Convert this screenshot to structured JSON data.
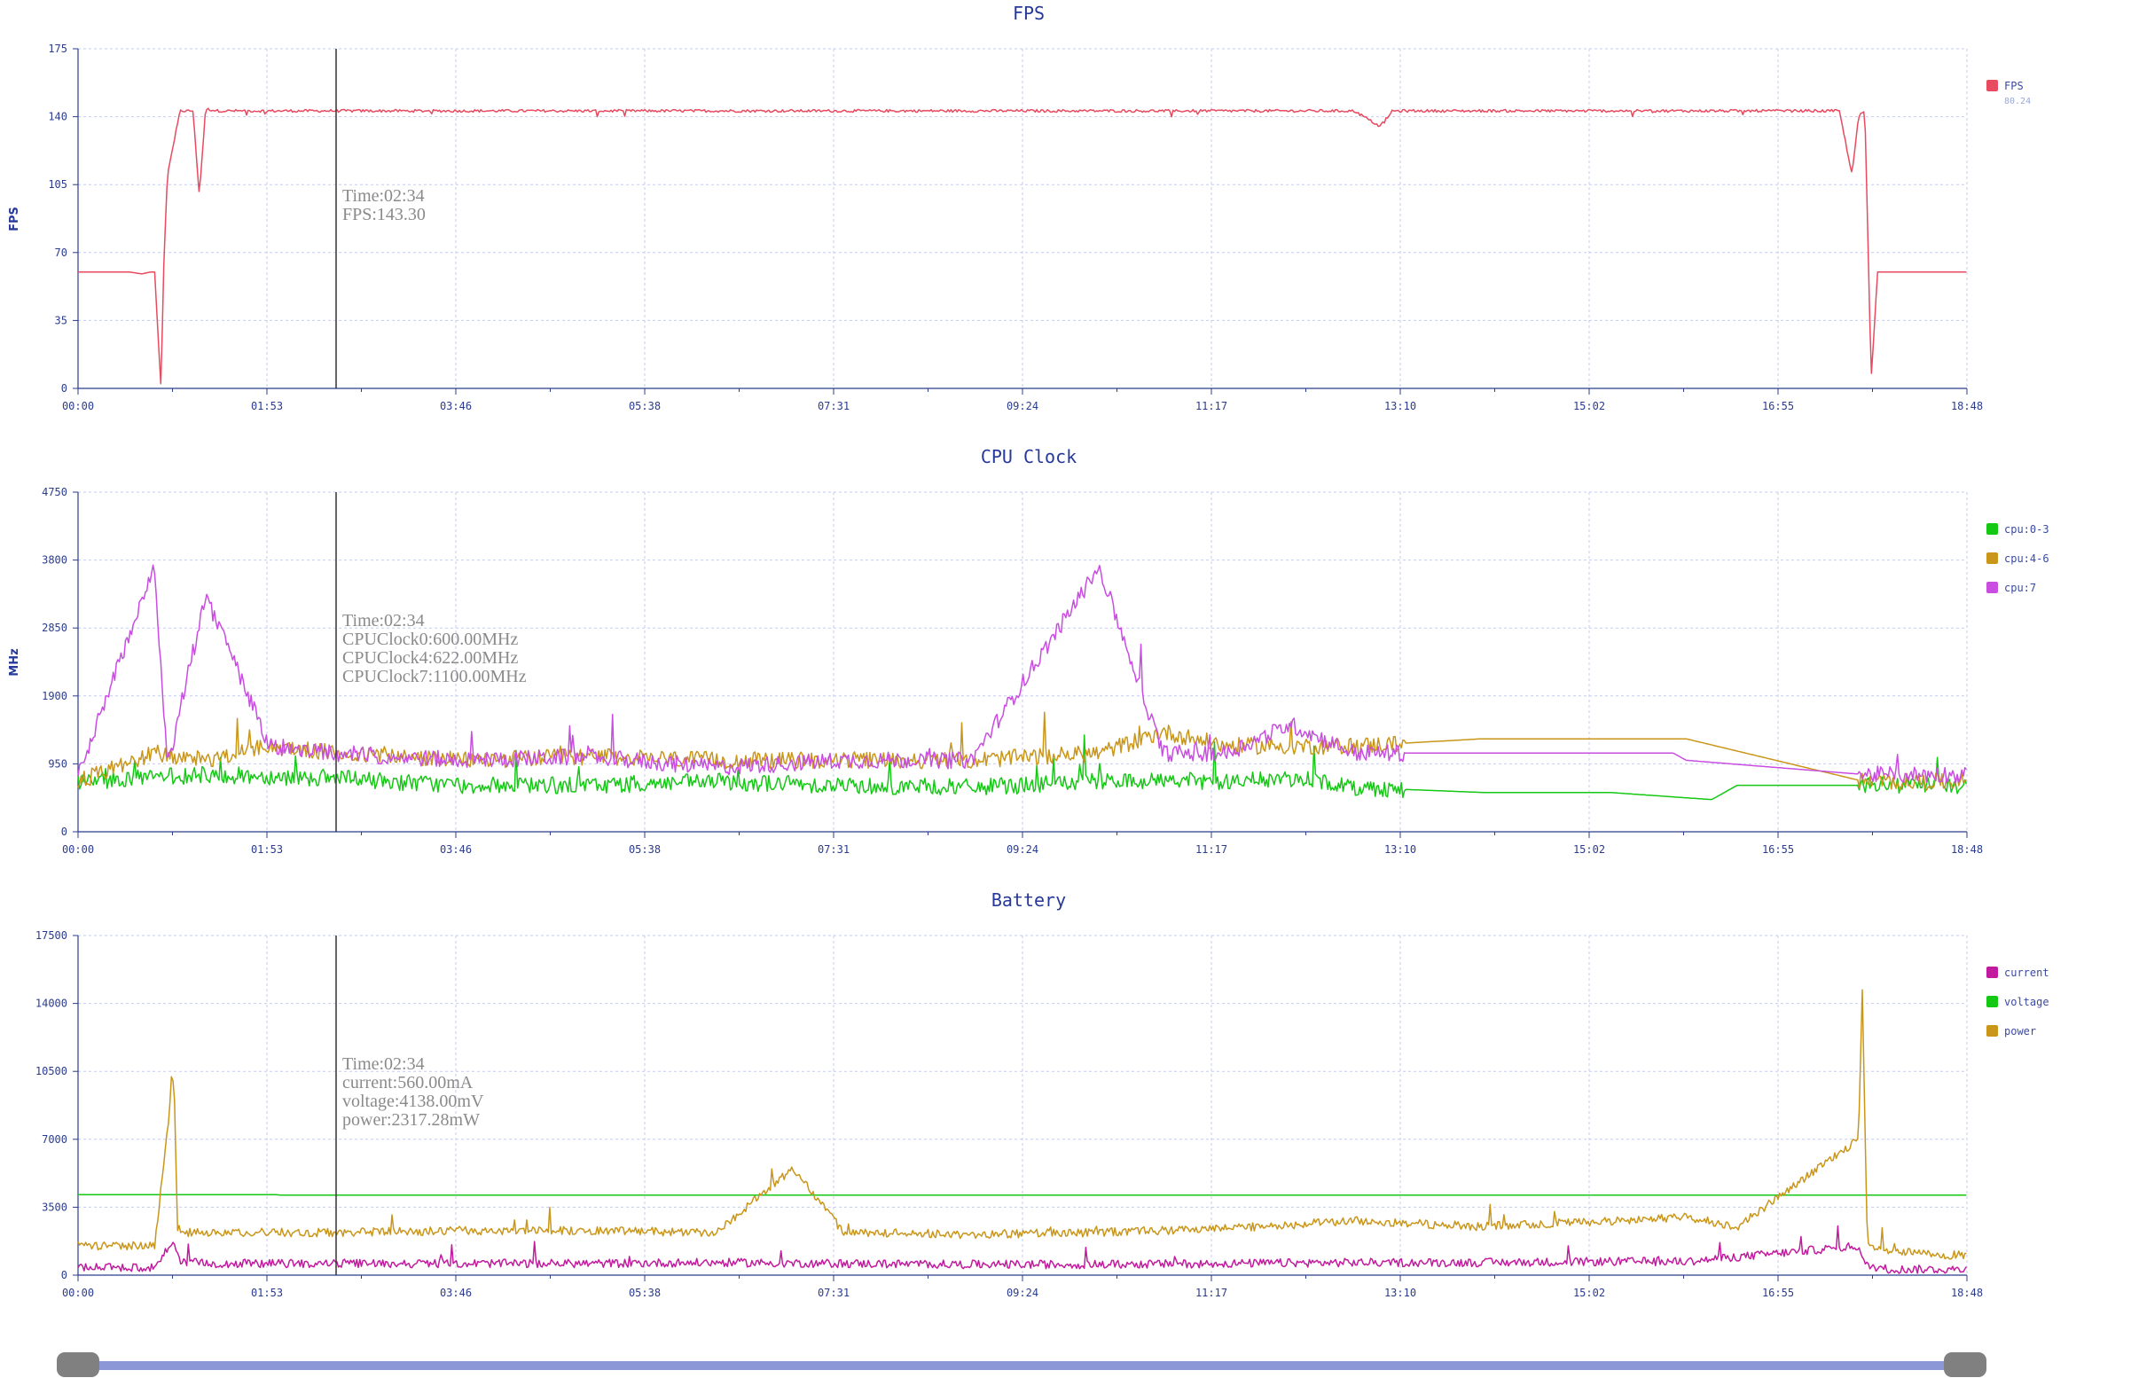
{
  "colors": {
    "axis": "#2b3c8e",
    "grid": "#c5cbee",
    "cursor": "#333333",
    "fps": "#e84a5f",
    "cpu0": "#14c814",
    "cpu4": "#c9961a",
    "cpu7": "#c84de0",
    "current": "#c21a9e",
    "voltage": "#14c814",
    "power": "#c9961a"
  },
  "time_ticks": [
    "00:00",
    "01:53",
    "03:46",
    "05:38",
    "07:31",
    "09:24",
    "11:17",
    "13:10",
    "15:02",
    "16:55",
    "18:48"
  ],
  "chart_data": [
    {
      "type": "line",
      "title": "FPS",
      "ylabel": "FPS",
      "ylim": [
        0,
        175
      ],
      "yticks": [
        "0",
        "35",
        "70",
        "105",
        "140",
        "175"
      ],
      "grid": true,
      "legend_position": "top-right",
      "series": [
        {
          "name": "FPS",
          "color_key": "fps",
          "legend_value": "80.24",
          "x": [
            0,
            40,
            50,
            57,
            60,
            65,
            67,
            70,
            80,
            90,
            95,
            100,
            110,
            120,
            130,
            154,
            200,
            400,
            600,
            800,
            1000,
            1020,
            1030,
            1040,
            1200,
            1350,
            1380,
            1390,
            1395,
            1400,
            1405,
            1410,
            1413,
            1420,
            1480
          ],
          "values": [
            60,
            60,
            59,
            60,
            60,
            0,
            60,
            110,
            143,
            143,
            100,
            144,
            143,
            143,
            143,
            143,
            143,
            143,
            143,
            143,
            143,
            135,
            143,
            143,
            143,
            143,
            143,
            110,
            140,
            143,
            5,
            60,
            60,
            60,
            60
          ]
        }
      ],
      "tooltip": {
        "time": "Time:02:34",
        "lines": [
          "FPS:143.30"
        ]
      }
    },
    {
      "type": "line",
      "title": "CPU Clock",
      "ylabel": "MHz",
      "ylim": [
        0,
        4750
      ],
      "yticks": [
        "0",
        "950",
        "1900",
        "2850",
        "3800",
        "4750"
      ],
      "grid": true,
      "legend_position": "top-right",
      "series": [
        {
          "name": "cpu:0-3",
          "color_key": "cpu0",
          "x": [
            0,
            100,
            200,
            300,
            400,
            500,
            600,
            700,
            800,
            850,
            900,
            960,
            1000,
            1100,
            1200,
            1280,
            1300,
            1400,
            1480
          ],
          "values": [
            700,
            800,
            750,
            650,
            650,
            700,
            650,
            620,
            700,
            720,
            700,
            750,
            620,
            550,
            550,
            450,
            650,
            650,
            650
          ]
        },
        {
          "name": "cpu:4-6",
          "color_key": "cpu4",
          "x": [
            0,
            60,
            100,
            150,
            200,
            300,
            400,
            500,
            600,
            700,
            800,
            850,
            900,
            1000,
            1100,
            1250,
            1260,
            1400,
            1480
          ],
          "values": [
            700,
            1100,
            1000,
            1200,
            1100,
            1000,
            1050,
            1000,
            1000,
            1000,
            1100,
            1400,
            1200,
            1200,
            1300,
            1300,
            1300,
            700,
            700
          ]
        },
        {
          "name": "cpu:7",
          "color_key": "cpu7",
          "x": [
            0,
            60,
            70,
            100,
            150,
            200,
            300,
            400,
            500,
            600,
            700,
            800,
            850,
            900,
            950,
            1000,
            1100,
            1250,
            1260,
            1400,
            1480
          ],
          "values": [
            800,
            3700,
            900,
            3300,
            1200,
            1100,
            1000,
            1050,
            900,
            1000,
            1000,
            3700,
            1100,
            1100,
            1500,
            1100,
            1100,
            1100,
            1000,
            800,
            800
          ]
        }
      ],
      "tooltip": {
        "time": "Time:02:34",
        "lines": [
          "CPUClock0:600.00MHz",
          "CPUClock4:622.00MHz",
          "CPUClock7:1100.00MHz"
        ]
      }
    },
    {
      "type": "line",
      "title": "Battery",
      "ylabel": "",
      "ylim": [
        0,
        17500
      ],
      "yticks": [
        "0",
        "3500",
        "7000",
        "10500",
        "14000",
        "17500"
      ],
      "grid": true,
      "legend_position": "top-right",
      "series": [
        {
          "name": "current",
          "color_key": "current",
          "x": [
            0,
            60,
            75,
            80,
            100,
            200,
            300,
            400,
            500,
            600,
            700,
            800,
            900,
            1000,
            1100,
            1200,
            1260,
            1395,
            1400,
            1420,
            1480
          ],
          "values": [
            400,
            400,
            1800,
            700,
            600,
            600,
            600,
            600,
            650,
            600,
            550,
            550,
            600,
            650,
            650,
            700,
            700,
            1500,
            500,
            300,
            300
          ]
        },
        {
          "name": "voltage",
          "color_key": "voltage",
          "x": [
            0,
            100,
            154,
            160,
            400,
            800,
            1200,
            1480
          ],
          "values": [
            4150,
            4150,
            4150,
            4120,
            4120,
            4120,
            4120,
            4120
          ]
        },
        {
          "name": "power",
          "color_key": "power",
          "x": [
            0,
            60,
            75,
            78,
            82,
            100,
            200,
            300,
            400,
            500,
            560,
            600,
            700,
            800,
            900,
            1000,
            1100,
            1200,
            1260,
            1300,
            1395,
            1398,
            1402,
            1420,
            1480
          ],
          "values": [
            1500,
            1500,
            10500,
            2500,
            2200,
            2200,
            2200,
            2300,
            2300,
            2200,
            5500,
            2200,
            2100,
            2200,
            2400,
            2800,
            2500,
            2800,
            3000,
            2500,
            7000,
            14500,
            1500,
            1200,
            1000
          ]
        }
      ],
      "tooltip": {
        "time": "Time:02:34",
        "lines": [
          "current:560.00mA",
          "voltage:4138.00mV",
          "power:2317.28mW"
        ]
      }
    }
  ]
}
